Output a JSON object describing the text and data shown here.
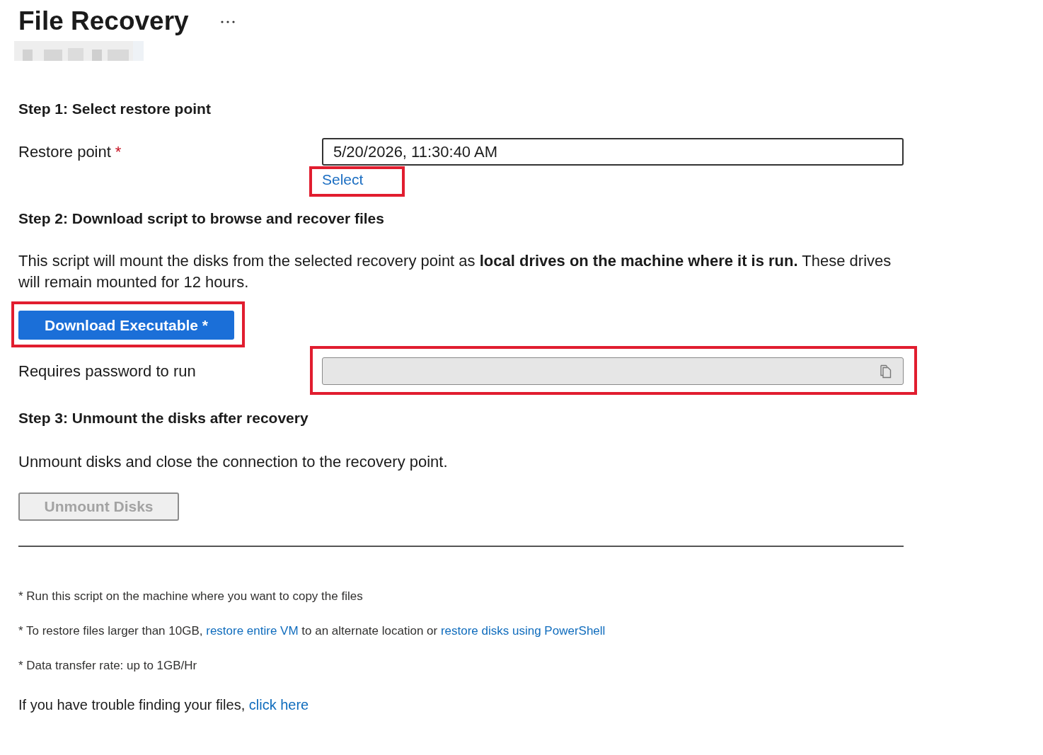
{
  "page": {
    "title": "File Recovery"
  },
  "step1": {
    "heading": "Step 1: Select restore point",
    "restore_point": {
      "label": "Restore point",
      "required_mark": "*",
      "value": "5/20/2026, 11:30:40 AM"
    },
    "select_link": {
      "text": "Select",
      "highlighted": true
    }
  },
  "step2": {
    "heading": "Step 2: Download script to browse and recover files",
    "description": "This script will mount the disks from the selected recovery point as **local drives on the machine where it is run.** These drives will remain mounted for 12 hours.",
    "download_button": {
      "label": "Download Executable *",
      "highlighted": true
    },
    "password": {
      "label": "Requires password to run",
      "disabled": true,
      "highlighted": true
    }
  },
  "step3": {
    "heading": "Step 3: Unmount the disks after recovery",
    "description": "Unmount disks and close the connection to the recovery point.",
    "unmount_button": {
      "label": "Unmount Disks",
      "disabled": true
    }
  },
  "notes": [
    {
      "segments": [
        {
          "kind": "text",
          "text": "* Run this script on the machine where you want to copy the files"
        }
      ]
    },
    {
      "segments": [
        {
          "kind": "text",
          "text": "* To restore files larger than 10GB, "
        },
        {
          "kind": "link",
          "text": "restore entire VM"
        },
        {
          "kind": "text",
          "text": " to an alternate location or "
        },
        {
          "kind": "link",
          "text": "restore disks using PowerShell"
        }
      ]
    },
    {
      "segments": [
        {
          "kind": "text",
          "text": "* Data transfer rate: up to 1GB/Hr"
        }
      ]
    }
  ],
  "help": {
    "segments": [
      {
        "kind": "text",
        "text": "If you have trouble finding your files, "
      },
      {
        "kind": "link",
        "text": "click here"
      }
    ]
  }
}
